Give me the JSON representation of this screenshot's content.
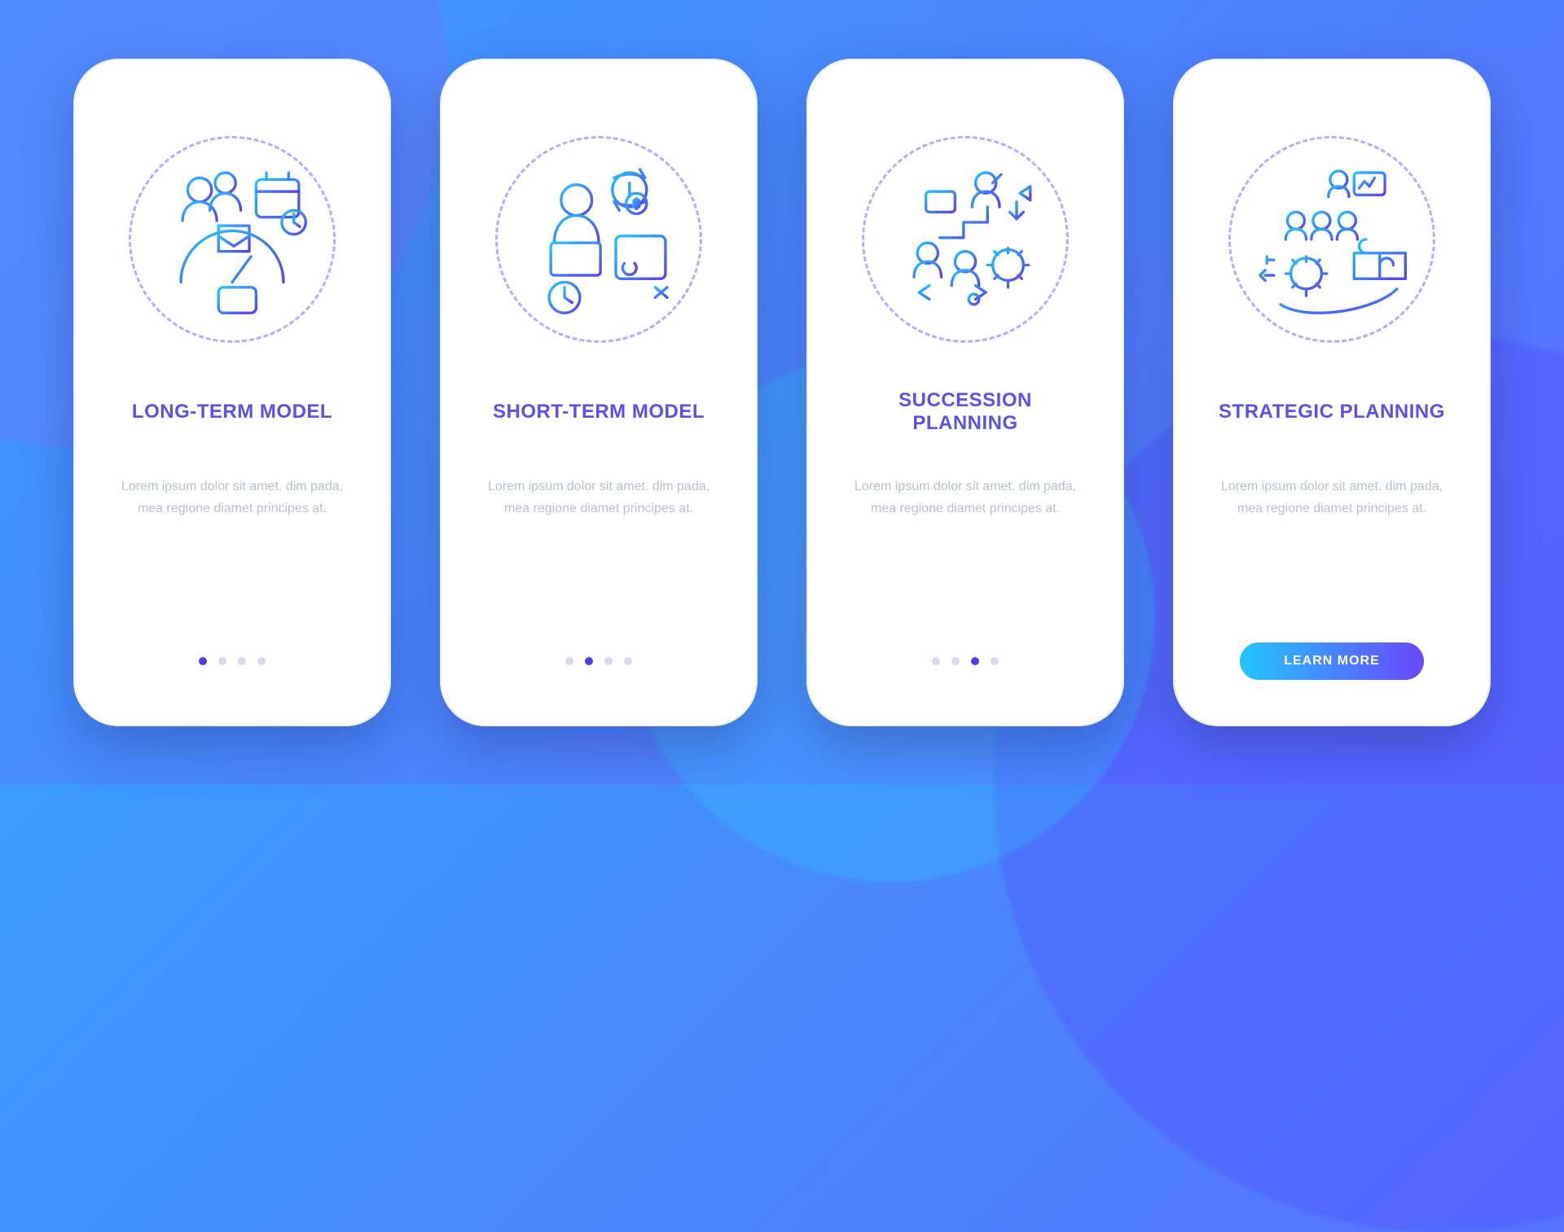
{
  "body_text": "Lorem ipsum dolor sit amet. dim pada, mea regione diamet principes at.",
  "cta_label": "LEARN MORE",
  "colors": {
    "accent_from": "#21c6ff",
    "accent_to": "#6a46ff",
    "title": "#5b51e8"
  },
  "slides": [
    {
      "id": "long-term",
      "title": "LONG-TERM MODEL",
      "icon": "calendar-team-gauge-icon",
      "page_index": 0,
      "page_count": 4,
      "has_cta": false
    },
    {
      "id": "short-term",
      "title": "SHORT-TERM MODEL",
      "icon": "cycle-money-clock-icon",
      "page_index": 1,
      "page_count": 4,
      "has_cta": false
    },
    {
      "id": "succession",
      "title": "SUCCESSION PLANNING",
      "icon": "career-path-icon",
      "page_index": 2,
      "page_count": 4,
      "has_cta": false
    },
    {
      "id": "strategic",
      "title": "STRATEGIC PLANNING",
      "icon": "org-puzzle-icon",
      "page_index": 3,
      "page_count": 4,
      "has_cta": true
    }
  ]
}
